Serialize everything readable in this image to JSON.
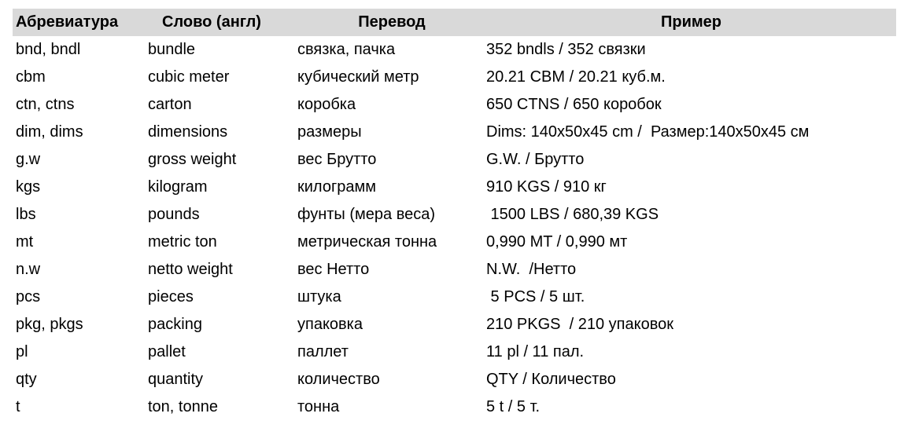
{
  "table": {
    "headers": [
      "Абревиатура",
      "Слово (англ)",
      "Перевод",
      "Пример"
    ],
    "header_background": "#d9d9d9",
    "rows": [
      [
        "bnd, bndl",
        "bundle",
        "связка, пачка",
        "352 bndls / 352 связки"
      ],
      [
        "cbm",
        "cubic meter",
        "кубический метр",
        "20.21 CBM / 20.21 куб.м."
      ],
      [
        "ctn, ctns",
        "carton",
        "коробка",
        "650 CTNS / 650 коробок"
      ],
      [
        "dim, dims",
        "dimensions",
        "размеры",
        "Dims: 140x50x45 cm /  Размер:140x50x45 см"
      ],
      [
        "g.w",
        "gross weight",
        "вес Брутто",
        "G.W. / Брутто"
      ],
      [
        "kgs",
        "kilogram",
        "килограмм",
        "910 KGS / 910 кг"
      ],
      [
        "lbs",
        "pounds",
        "фунты (мера веса)",
        " 1500 LBS / 680,39 KGS"
      ],
      [
        "mt",
        "metric ton",
        "метрическая тонна",
        "0,990 MT / 0,990 мт"
      ],
      [
        "n.w",
        "netto weight",
        "вес Нетто",
        "N.W.  /Нетто"
      ],
      [
        "pcs",
        "pieces",
        "штука",
        " 5 PCS / 5 шт."
      ],
      [
        "pkg, pkgs",
        "packing",
        "упаковка",
        "210 PKGS  / 210 упаковок"
      ],
      [
        "pl",
        "pallet",
        "паллет",
        "11 pl / 11 пал."
      ],
      [
        "qty",
        "quantity",
        "количество",
        "QTY / Количество"
      ],
      [
        "t",
        "ton, tonne",
        "тонна",
        "5 t / 5 т."
      ]
    ]
  }
}
